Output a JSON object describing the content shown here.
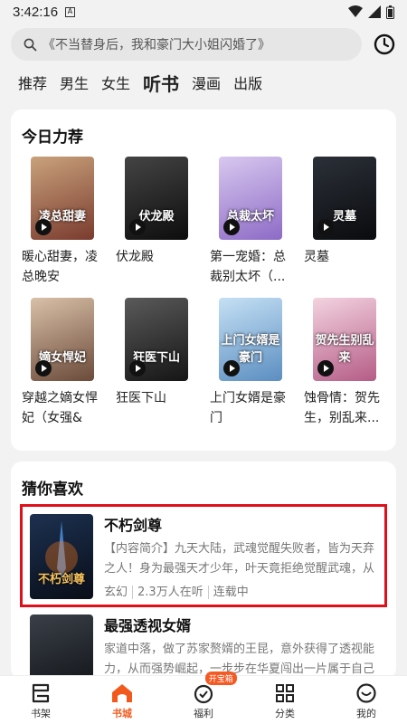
{
  "status_bar": {
    "time": "3:42:16",
    "sim_label": "A"
  },
  "search": {
    "placeholder": "《不当替身后，我和豪门大小姐闪婚了》"
  },
  "tabs": [
    {
      "label": "推荐"
    },
    {
      "label": "男生"
    },
    {
      "label": "女生"
    },
    {
      "label": "听书"
    },
    {
      "label": "漫画"
    },
    {
      "label": "出版"
    }
  ],
  "active_tab": "听书",
  "recommend": {
    "title": "今日力荐",
    "books": [
      {
        "name": "暖心甜妻，凌总晚安",
        "cover_text": "凌总甜妻",
        "colors": [
          "#c9a27c",
          "#7a3b2e"
        ]
      },
      {
        "name": "伏龙殿",
        "cover_text": "伏龙殿",
        "colors": [
          "#444",
          "#0d0d0d"
        ]
      },
      {
        "name": "第一宠婚：总裁别太坏（...",
        "cover_text": "总裁太坏",
        "colors": [
          "#d8c8ef",
          "#8d6bc6"
        ]
      },
      {
        "name": "灵墓",
        "cover_text": "灵墓",
        "colors": [
          "#2b3038",
          "#0a0b0e"
        ]
      },
      {
        "name": "穿越之嫡女悍妃（女强&宫...",
        "cover_text": "嫡女悍妃",
        "colors": [
          "#d9c0a8",
          "#6b4a3a"
        ]
      },
      {
        "name": "狂医下山",
        "cover_text": "狂医下山",
        "colors": [
          "#5a5a5a",
          "#151515"
        ]
      },
      {
        "name": "上门女婿是豪门",
        "cover_text": "上门女婿是豪门",
        "colors": [
          "#c5e0f4",
          "#5b8ec1"
        ]
      },
      {
        "name": "蚀骨情：贺先生，别乱来...",
        "cover_text": "贺先生别乱来",
        "colors": [
          "#f3d3e0",
          "#b55c86"
        ]
      }
    ]
  },
  "guess": {
    "title": "猜你喜欢",
    "items": [
      {
        "title": "不朽剑尊",
        "desc": "【内容简介】九天大陆，武魂觉醒失败者，皆为天弃之人！身为最强天才少年，叶天竟拒绝觉醒武魂，从此沦...",
        "meta": [
          "玄幻",
          "2.3万人在听",
          "连载中"
        ],
        "cover_text": "不朽剑尊",
        "colors": [
          "#1c3150",
          "#090d18"
        ]
      },
      {
        "title": "最强透视女婿",
        "desc": "家道中落，做了苏家赘婿的王昆，意外获得了透视能力，从而强势崛起，一步步在华夏闯出一片属于自己的...",
        "meta": [],
        "cover_text": "",
        "colors": [
          "#3a4048",
          "#0e1014"
        ]
      }
    ]
  },
  "bottom_nav": [
    {
      "label": "书架",
      "icon": "bookshelf-icon"
    },
    {
      "label": "书城",
      "icon": "bookstore-icon",
      "active": true
    },
    {
      "label": "福利",
      "icon": "welfare-icon",
      "badge": "开宝箱"
    },
    {
      "label": "分类",
      "icon": "category-icon"
    },
    {
      "label": "我的",
      "icon": "profile-icon"
    }
  ],
  "colors": {
    "accent": "#f25a1d",
    "highlight_border": "#e0101b"
  }
}
